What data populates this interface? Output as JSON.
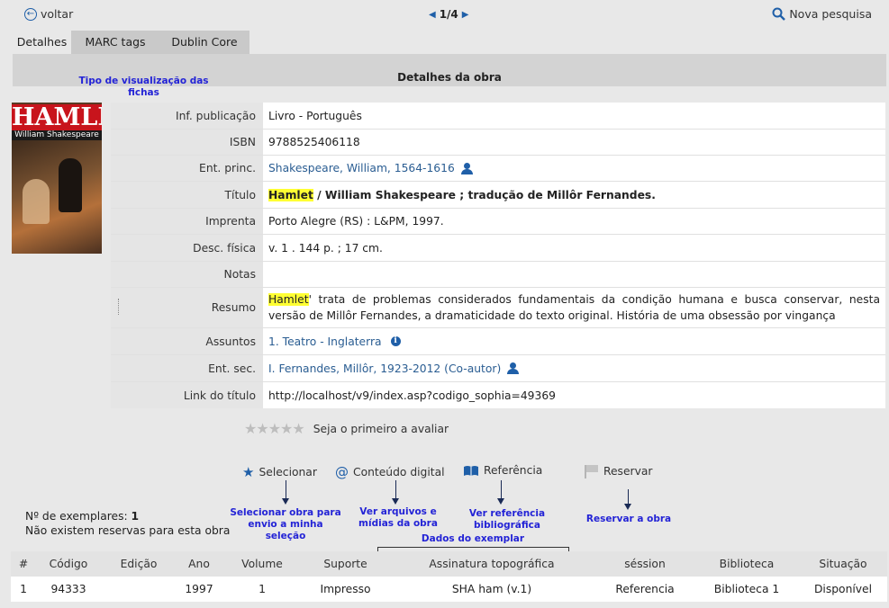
{
  "nav": {
    "back_label": "voltar",
    "pager": "1/4",
    "new_search_label": "Nova pesquisa"
  },
  "tabs": [
    {
      "label": "Detalhes",
      "active": true
    },
    {
      "label": "MARC tags",
      "active": false
    },
    {
      "label": "Dublin Core",
      "active": false
    }
  ],
  "header": {
    "title": "Detalhes da obra",
    "annotation": "Tipo de visualização das fichas"
  },
  "cover": {
    "title": "HAMLET",
    "author": "William Shakespeare"
  },
  "fields": {
    "pub_label": "Inf. publicação",
    "pub_value": "Livro - Português",
    "isbn_label": "ISBN",
    "isbn_value": "9788525406118",
    "author_label": "Ent. princ.",
    "author_value": "Shakespeare, William, 1564-1616",
    "title_label": "Título",
    "title_highlight": "Hamlet",
    "title_rest": " / William Shakespeare ; tradução de Millôr Fernandes.",
    "imprint_label": "Imprenta",
    "imprint_value": "Porto Alegre (RS) : L&PM, 1997.",
    "physical_label": "Desc. física",
    "physical_value": "v. 1 . 144 p. ; 17 cm.",
    "notes_label": "Notas",
    "notes_value": "",
    "summary_label": "Resumo",
    "summary_highlight": "Hamlet",
    "summary_rest": "' trata de problemas considerados fundamentais da condição humana e busca conservar, nesta versão de Millôr Fernandes, a dramaticidade do texto original. História de uma obsessão por vingança",
    "subjects_label": "Assuntos",
    "subjects_value": "1. Teatro - Inglaterra",
    "secondary_label": "Ent. sec.",
    "secondary_value": "I. Fernandes, Millôr, 1923-2012 (Co-autor)",
    "link_label": "Link do título",
    "link_value": "http://localhost/v9/index.asp?codigo_sophia=49369"
  },
  "rating": {
    "text": "Seja o primeiro a avaliar",
    "stars": 0,
    "max": 5
  },
  "actions": {
    "select": "Selecionar",
    "digital": "Conteúdo digital",
    "reference": "Referência",
    "reserve": "Reservar"
  },
  "annotations": {
    "select": "Selecionar obra para envio a minha seleção",
    "digital": "Ver arquivos e mídias da obra",
    "reference": "Ver referência bibliográfica",
    "reserve": "Reservar a obra",
    "copy_data": "Dados do exemplar"
  },
  "copies": {
    "count_label": "Nº de exemplares: ",
    "count": "1",
    "reservations": "Não existem reservas para esta obra"
  },
  "table": {
    "headers": [
      "#",
      "Código",
      "Edição",
      "Ano",
      "Volume",
      "Suporte",
      "Assinatura topográfica",
      "séssion",
      "Biblioteca",
      "Situação"
    ],
    "rows": [
      [
        "1",
        "94333",
        "",
        "1997",
        "1",
        "Impresso",
        "SHA ham (v.1)",
        "Referencia",
        "Biblioteca 1",
        "Disponível"
      ]
    ]
  },
  "colors": {
    "accent": "#1f5fa8",
    "annotation": "#2323d6",
    "highlight": "#ffff33"
  }
}
